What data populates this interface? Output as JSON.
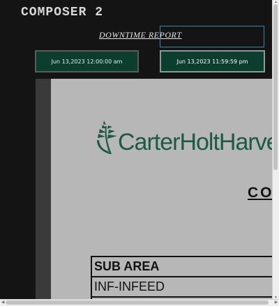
{
  "header": {
    "app_title": "COMPOSER 2",
    "report_link": "DOWNTIME REPORT"
  },
  "date_range": {
    "start": "Jun 13,2023 12:00:00 am",
    "end": "Jun 13,2023 11:59:59 pm"
  },
  "report": {
    "logo_text": "CarterHoltHarvey",
    "logo_alt": "Carter Holt Harvey logo",
    "heading": "CO",
    "table": {
      "header": "SUB AREA",
      "rows": [
        "INF-INFEED"
      ]
    }
  },
  "colors": {
    "background": "#141414",
    "button_bg": "#0b3e2e",
    "brand_green": "#1d5a45",
    "viewer_bg": "#b7b7b7"
  },
  "icons": {
    "scroll_up": "triangle-up",
    "scroll_down": "triangle-down",
    "scroll_left": "triangle-left",
    "scroll_right": "triangle-right"
  }
}
